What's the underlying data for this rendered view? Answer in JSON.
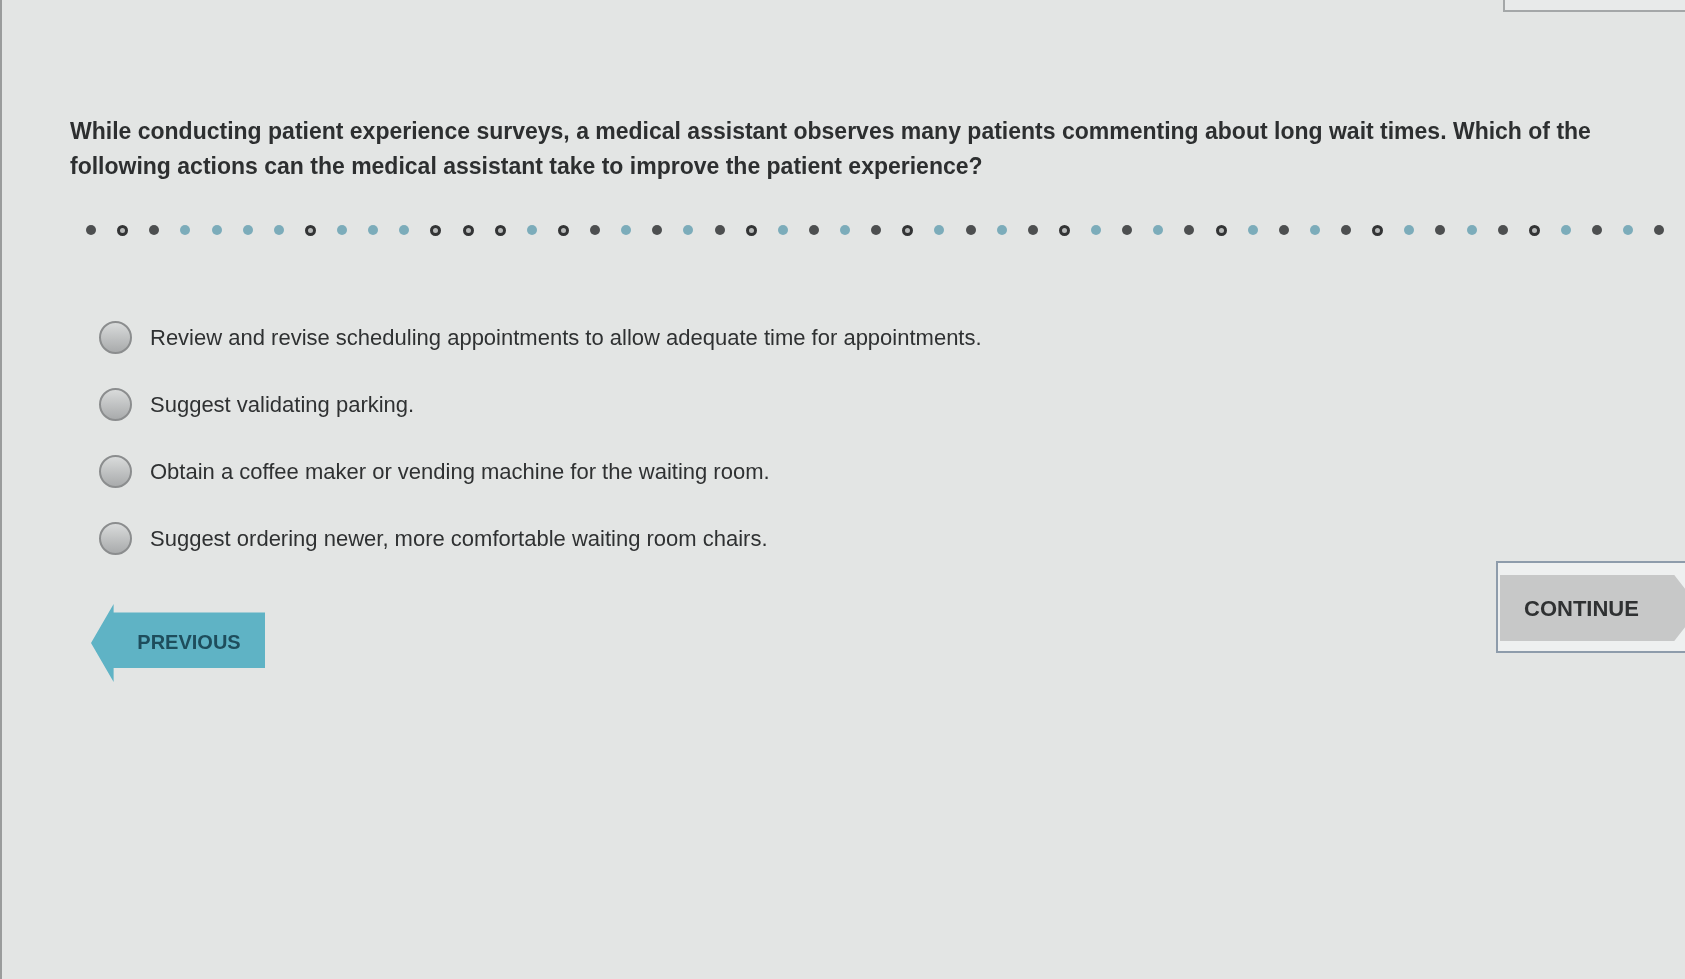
{
  "question": "While conducting patient experience surveys, a medical assistant observes many patients commenting about long wait times. Which of the following actions can the medical assistant take to improve the patient experience?",
  "progress_dots": [
    {
      "kind": "dot",
      "color": "#4d4f50"
    },
    {
      "kind": "ring",
      "color": "#333435"
    },
    {
      "kind": "dot",
      "color": "#4d4f50"
    },
    {
      "kind": "dot",
      "color": "#7cacba"
    },
    {
      "kind": "dot",
      "color": "#7cacba"
    },
    {
      "kind": "dot",
      "color": "#7cacba"
    },
    {
      "kind": "dot",
      "color": "#7cacba"
    },
    {
      "kind": "ring",
      "color": "#333435"
    },
    {
      "kind": "dot",
      "color": "#7cacba"
    },
    {
      "kind": "dot",
      "color": "#7cacba"
    },
    {
      "kind": "dot",
      "color": "#7cacba"
    },
    {
      "kind": "ring",
      "color": "#333435"
    },
    {
      "kind": "ring",
      "color": "#333435"
    },
    {
      "kind": "ring",
      "color": "#333435"
    },
    {
      "kind": "dot",
      "color": "#7cacba"
    },
    {
      "kind": "ring",
      "color": "#333435"
    },
    {
      "kind": "dot",
      "color": "#4d4f50"
    },
    {
      "kind": "dot",
      "color": "#7cacba"
    },
    {
      "kind": "dot",
      "color": "#4d4f50"
    },
    {
      "kind": "dot",
      "color": "#7cacba"
    },
    {
      "kind": "dot",
      "color": "#4d4f50"
    },
    {
      "kind": "ring",
      "color": "#333435"
    },
    {
      "kind": "dot",
      "color": "#7cacba"
    },
    {
      "kind": "dot",
      "color": "#4d4f50"
    },
    {
      "kind": "dot",
      "color": "#7cacba"
    },
    {
      "kind": "dot",
      "color": "#4d4f50"
    },
    {
      "kind": "ring",
      "color": "#333435"
    },
    {
      "kind": "dot",
      "color": "#7cacba"
    },
    {
      "kind": "dot",
      "color": "#4d4f50"
    },
    {
      "kind": "dot",
      "color": "#7cacba"
    },
    {
      "kind": "dot",
      "color": "#4d4f50"
    },
    {
      "kind": "ring",
      "color": "#333435"
    },
    {
      "kind": "dot",
      "color": "#7cacba"
    },
    {
      "kind": "dot",
      "color": "#4d4f50"
    },
    {
      "kind": "dot",
      "color": "#7cacba"
    },
    {
      "kind": "dot",
      "color": "#4d4f50"
    },
    {
      "kind": "ring",
      "color": "#333435"
    },
    {
      "kind": "dot",
      "color": "#7cacba"
    },
    {
      "kind": "dot",
      "color": "#4d4f50"
    },
    {
      "kind": "dot",
      "color": "#7cacba"
    },
    {
      "kind": "dot",
      "color": "#4d4f50"
    },
    {
      "kind": "ring",
      "color": "#333435"
    },
    {
      "kind": "dot",
      "color": "#7cacba"
    },
    {
      "kind": "dot",
      "color": "#4d4f50"
    },
    {
      "kind": "dot",
      "color": "#7cacba"
    },
    {
      "kind": "dot",
      "color": "#4d4f50"
    },
    {
      "kind": "ring",
      "color": "#333435"
    },
    {
      "kind": "dot",
      "color": "#7cacba"
    },
    {
      "kind": "dot",
      "color": "#4d4f50"
    },
    {
      "kind": "dot",
      "color": "#7cacba"
    },
    {
      "kind": "dot",
      "color": "#4d4f50"
    }
  ],
  "options": [
    {
      "label": "Review and revise scheduling appointments to allow adequate time for appointments.",
      "selected": false
    },
    {
      "label": "Suggest validating parking.",
      "selected": false
    },
    {
      "label": "Obtain a coffee maker or vending machine for the waiting room.",
      "selected": false
    },
    {
      "label": "Suggest ordering newer, more comfortable waiting room chairs.",
      "selected": false
    }
  ],
  "buttons": [
    {
      "kind": "previous",
      "label": "PREVIOUS"
    },
    {
      "kind": "continue",
      "label": "CONTINUE"
    }
  ]
}
